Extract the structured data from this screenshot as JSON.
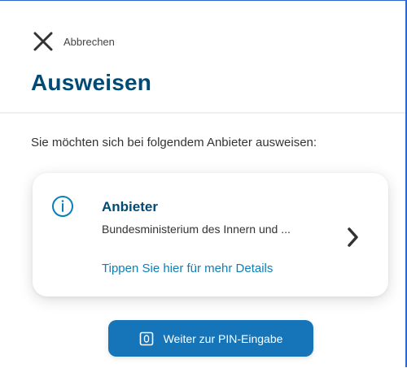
{
  "header": {
    "cancel_label": "Abbrechen",
    "title": "Ausweisen"
  },
  "main": {
    "intro_text": "Sie möchten sich bei folgendem Anbieter ausweisen:",
    "provider_card": {
      "heading": "Anbieter",
      "provider_name": "Bundesministerium des Innern und ...",
      "details_link": "Tippen Sie hier für mehr Details"
    },
    "continue_button_label": "Weiter zur PIN-Eingabe"
  },
  "icons": {
    "close": "close-icon",
    "info": "info-icon",
    "chevron": "chevron-right-icon",
    "pin": "pin-entry-icon"
  },
  "colors": {
    "title": "#004b76",
    "link": "#0d7fb8",
    "button": "#1575b8",
    "frame_border": "#2f66d2"
  }
}
